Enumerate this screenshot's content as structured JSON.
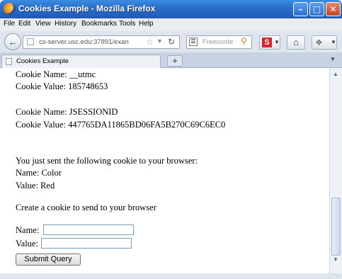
{
  "window": {
    "title": "Cookies Example - Mozilla Firefox",
    "controls": {
      "minimize": "–",
      "maximize": "□",
      "close": "✕"
    }
  },
  "menu": [
    "File",
    "Edit",
    "View",
    "History",
    "Bookmarks",
    "Tools",
    "Help"
  ],
  "nav": {
    "back_icon": "back-arrow-icon",
    "url": "cs-server.usc.edu:37891/exan",
    "search_placeholder": "Freecorde"
  },
  "tabs": [
    {
      "label": "Cookies Example"
    }
  ],
  "content": {
    "cookie1_name": "Cookie Name: __utmc",
    "cookie1_value": "Cookie Value: 185748653",
    "cookie2_name": "Cookie Name: JSESSIONID",
    "cookie2_value": "Cookie Value: 447765DA11865BD06FA5B270C69C6EC0",
    "sent_heading": "You just sent the following cookie to your browser:",
    "sent_name": "Name: Color",
    "sent_value": "Value: Red",
    "create_heading": "Create a cookie to send to your browser",
    "name_label": "Name:",
    "value_label": "Value:",
    "name_input": "",
    "value_input": "",
    "submit_label": "Submit Query"
  },
  "colors": {
    "titlebar": "#2a6fc9",
    "close_button": "#c4431f",
    "brand_red": "#d8232a"
  }
}
